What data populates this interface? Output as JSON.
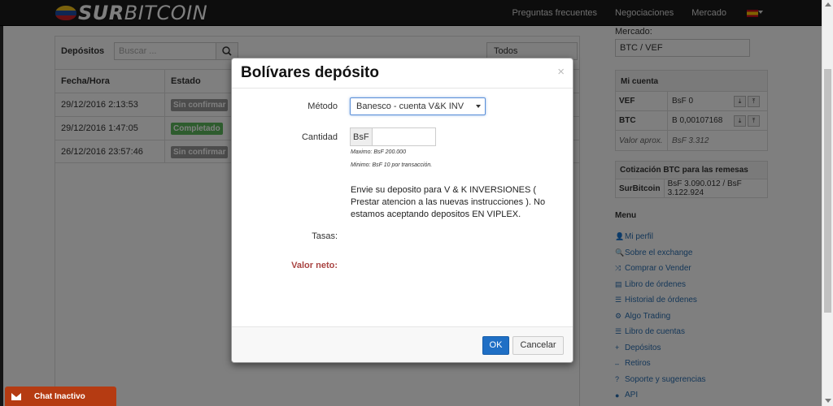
{
  "navbar": {
    "logo_text_bold": "SUR",
    "logo_text_light": "BITCOIN",
    "links": [
      "Preguntas frecuentes",
      "Negociaciones",
      "Mercado"
    ]
  },
  "deposits": {
    "title": "Depósitos",
    "search_placeholder": "Buscar ...",
    "filter": "Todos",
    "columns": [
      "Fecha/Hora",
      "Estado"
    ],
    "rows": [
      {
        "date": "29/12/2016 2:13:53",
        "state": "Sin confirmar",
        "color": "#999999"
      },
      {
        "date": "29/12/2016 1:47:05",
        "state": "Completado",
        "color": "#5cb85c"
      },
      {
        "date": "26/12/2016 23:57:46",
        "state": "Sin confirmar",
        "color": "#999999"
      }
    ]
  },
  "sidebar": {
    "market_label": "Mercado:",
    "market_value": "BTC / VEF",
    "account": {
      "title": "Mi cuenta",
      "rows": [
        {
          "currency": "VEF",
          "balance": "BsF 0"
        },
        {
          "currency": "BTC",
          "balance": "B 0,00107168"
        }
      ],
      "approx_label": "Valor aprox.",
      "approx_value": "BsF 3.312"
    },
    "quote": {
      "title": "Cotización BTC para las remesas",
      "source": "SurBitcoin",
      "value": "BsF 3.090.012 / BsF 3.122.924"
    },
    "menu_title": "Menu",
    "menu": [
      {
        "icon": "user-icon",
        "glyph": "👤",
        "label": "Mi perfil"
      },
      {
        "icon": "search-icon",
        "glyph": "🔍",
        "label": "Sobre el exchange"
      },
      {
        "icon": "shuffle-icon",
        "glyph": "⤨",
        "label": "Comprar o Vender"
      },
      {
        "icon": "book-icon",
        "glyph": "▤",
        "label": "Libro de órdenes"
      },
      {
        "icon": "list-icon",
        "glyph": "☰",
        "label": "Historial de órdenes"
      },
      {
        "icon": "cogs-icon",
        "glyph": "⚙",
        "label": "Algo Trading"
      },
      {
        "icon": "list-icon",
        "glyph": "☰",
        "label": "Libro de cuentas"
      },
      {
        "icon": "plus-icon",
        "glyph": "+",
        "label": "Depósitos"
      },
      {
        "icon": "minus-icon",
        "glyph": "–",
        "label": "Retiros"
      },
      {
        "icon": "question-icon",
        "glyph": "?",
        "label": "Soporte y sugerencias"
      },
      {
        "icon": "globe-icon",
        "glyph": "●",
        "label": "API"
      }
    ]
  },
  "modal": {
    "title": "Bolívares depósito",
    "close": "×",
    "method_label": "Método",
    "method_value": "Banesco - cuenta V&K INV",
    "amount_label": "Cantidad",
    "amount_addon": "BsF",
    "max_help": "Maximo: BsF 200.000",
    "min_help": "Minimo: BsF 10 por transacción.",
    "instructions": "Envie su deposito para V & K INVERSIONES ( Prestar atencion a las nuevas instrucciones ). No estamos aceptando depositos EN VIPLEX.",
    "fees_label": "Tasas:",
    "net_label": "Valor neto:",
    "ok_label": "OK",
    "cancel_label": "Cancelar"
  },
  "chat": {
    "label": "Chat Inactivo"
  }
}
